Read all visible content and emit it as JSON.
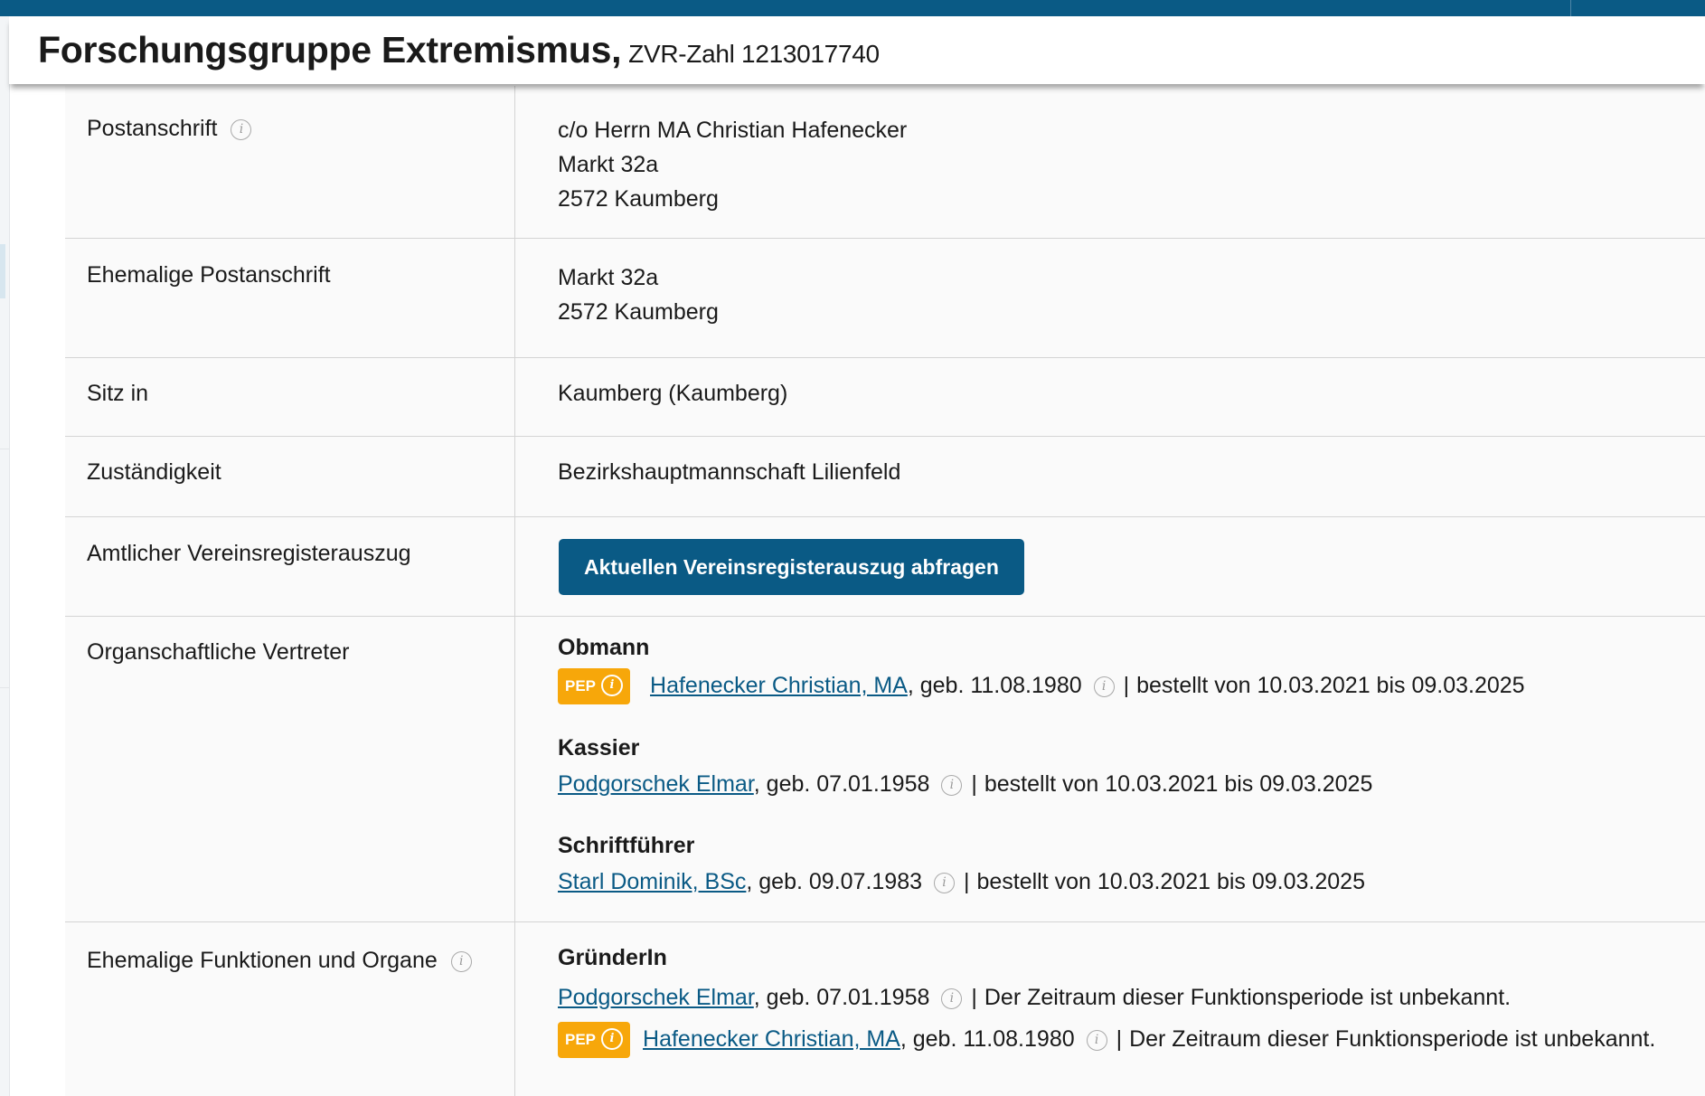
{
  "header": {
    "title": "Forschungsgruppe Extremismus,",
    "zvr": "ZVR-Zahl 1213017740"
  },
  "rows": {
    "postanschrift": {
      "label": "Postanschrift",
      "lines": [
        "c/o Herrn MA Christian Hafenecker",
        "Markt 32a",
        "2572 Kaumberg"
      ]
    },
    "ehemalige_postanschrift": {
      "label": "Ehemalige Postanschrift",
      "lines": [
        "Markt 32a",
        "2572 Kaumberg"
      ]
    },
    "sitz": {
      "label": "Sitz in",
      "value": "Kaumberg (Kaumberg)"
    },
    "zustaendigkeit": {
      "label": "Zuständigkeit",
      "value": "Bezirkshauptmannschaft Lilienfeld"
    },
    "auszug": {
      "label": "Amtlicher Vereinsregisterauszug",
      "button_label": "Aktuellen Vereinsregisterauszug abfragen"
    },
    "vertreter": {
      "label": "Organschaftliche Vertreter",
      "roles": [
        {
          "role": "Obmann",
          "persons": [
            {
              "pep": true,
              "name": "Hafenecker Christian, MA",
              "birth": ", geb. 11.08.1980",
              "period": "bestellt von 10.03.2021 bis 09.03.2025"
            }
          ]
        },
        {
          "role": "Kassier",
          "persons": [
            {
              "pep": false,
              "name": "Podgorschek Elmar",
              "birth": ", geb. 07.01.1958",
              "period": "bestellt von 10.03.2021 bis 09.03.2025"
            }
          ]
        },
        {
          "role": "Schriftführer",
          "persons": [
            {
              "pep": false,
              "name": "Starl Dominik, BSc",
              "birth": ", geb. 09.07.1983",
              "period": "bestellt von 10.03.2021 bis 09.03.2025"
            }
          ]
        }
      ]
    },
    "ehemalige": {
      "label": "Ehemalige Funktionen und Organe",
      "roles": [
        {
          "role": "GründerIn",
          "persons": [
            {
              "pep": false,
              "name": "Podgorschek Elmar",
              "birth": ", geb. 07.01.1958",
              "period": "Der Zeitraum dieser Funktionsperiode ist unbekannt."
            },
            {
              "pep": true,
              "name": "Hafenecker Christian, MA",
              "birth": ", geb. 11.08.1980",
              "period": "Der Zeitraum dieser Funktionsperiode ist unbekannt."
            }
          ]
        }
      ]
    }
  },
  "ui": {
    "pep_label": "PEP",
    "info_glyph": "i",
    "separator": "|"
  },
  "icons": {
    "info": "info-circle-icon",
    "pep_info": "pep-info-icon"
  },
  "colors": {
    "brand": "#0a5a85",
    "pep": "#f7a70a",
    "link": "#0a5a85"
  }
}
